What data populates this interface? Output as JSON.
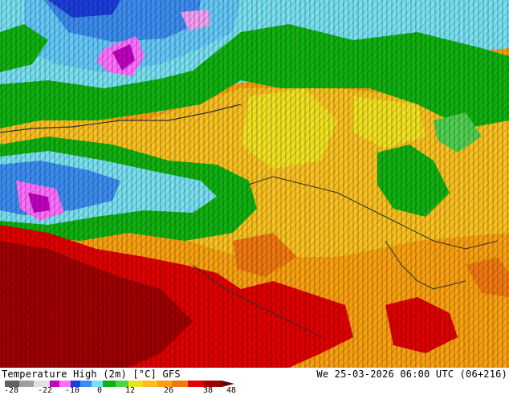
{
  "map": {
    "field": "temperature-high-2m",
    "palette": {
      "purple": "#c000c0",
      "magenta": "#ff70ff",
      "pink": "#f4a0f4",
      "blue_dark": "#1c3cdc",
      "blue": "#3c8cf0",
      "light_blue": "#64c8f8",
      "cyan": "#78e0f0",
      "green": "#10b010",
      "light_green": "#50d050",
      "yellow": "#f0e020",
      "yellow_orange": "#f8c020",
      "orange": "#f8a010",
      "dark_orange": "#f07810",
      "red": "#e00000",
      "dark_red": "#a00000",
      "contour": "#000000"
    }
  },
  "footer": {
    "title": "Temperature High (2m) [°C] GFS",
    "datetime": "We 25-03-2026 06:00 UTC (06+216)",
    "legend_ticks": [
      "-28",
      "-22",
      "-10",
      "0",
      "12",
      "26",
      "38",
      "48"
    ]
  }
}
